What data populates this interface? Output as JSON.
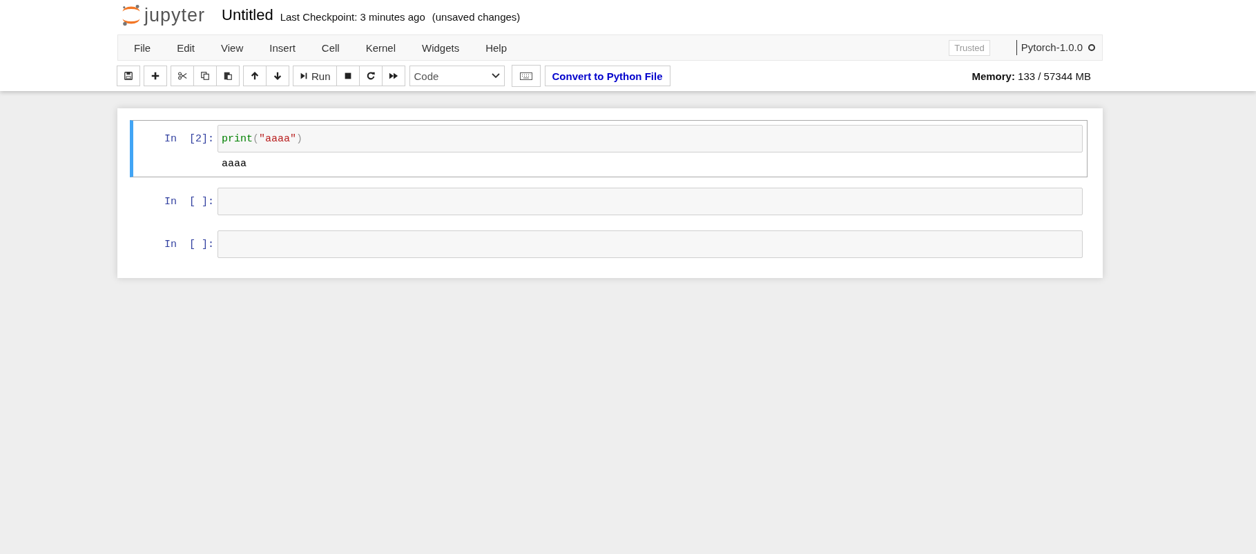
{
  "header": {
    "logo_text": "jupyter",
    "notebook_name": "Untitled",
    "checkpoint": "Last Checkpoint: 3 minutes ago",
    "autosave_status": "(unsaved changes)"
  },
  "menubar": {
    "items": [
      "File",
      "Edit",
      "View",
      "Insert",
      "Cell",
      "Kernel",
      "Widgets",
      "Help"
    ],
    "trusted": "Trusted",
    "kernel": {
      "name": "Pytorch-1.0.0",
      "busy": false
    }
  },
  "toolbar": {
    "groups": [
      [
        {
          "kind": "save"
        }
      ],
      [
        {
          "kind": "add"
        }
      ],
      [
        {
          "kind": "cut"
        },
        {
          "kind": "copy"
        },
        {
          "kind": "paste"
        }
      ],
      [
        {
          "kind": "up"
        },
        {
          "kind": "down"
        }
      ],
      [
        {
          "kind": "run",
          "label": "Run"
        },
        {
          "kind": "stop"
        },
        {
          "kind": "restart"
        },
        {
          "kind": "fast-forward"
        }
      ]
    ],
    "cell_type": "Code",
    "convert_button": "Convert to Python File",
    "memory_label": "Memory:",
    "memory_value": "133 / 57344 MB"
  },
  "cells": [
    {
      "prompt": "In  [2]:",
      "selected": true,
      "code": [
        {
          "kind": "builtin",
          "text": "print"
        },
        {
          "kind": "paren",
          "text": "("
        },
        {
          "kind": "string",
          "text": "\"aaaa\""
        },
        {
          "kind": "paren",
          "text": ")"
        }
      ],
      "output": "aaaa"
    },
    {
      "prompt": "In  [ ]:",
      "selected": false
    },
    {
      "prompt": "In  [ ]:",
      "selected": false
    }
  ]
}
